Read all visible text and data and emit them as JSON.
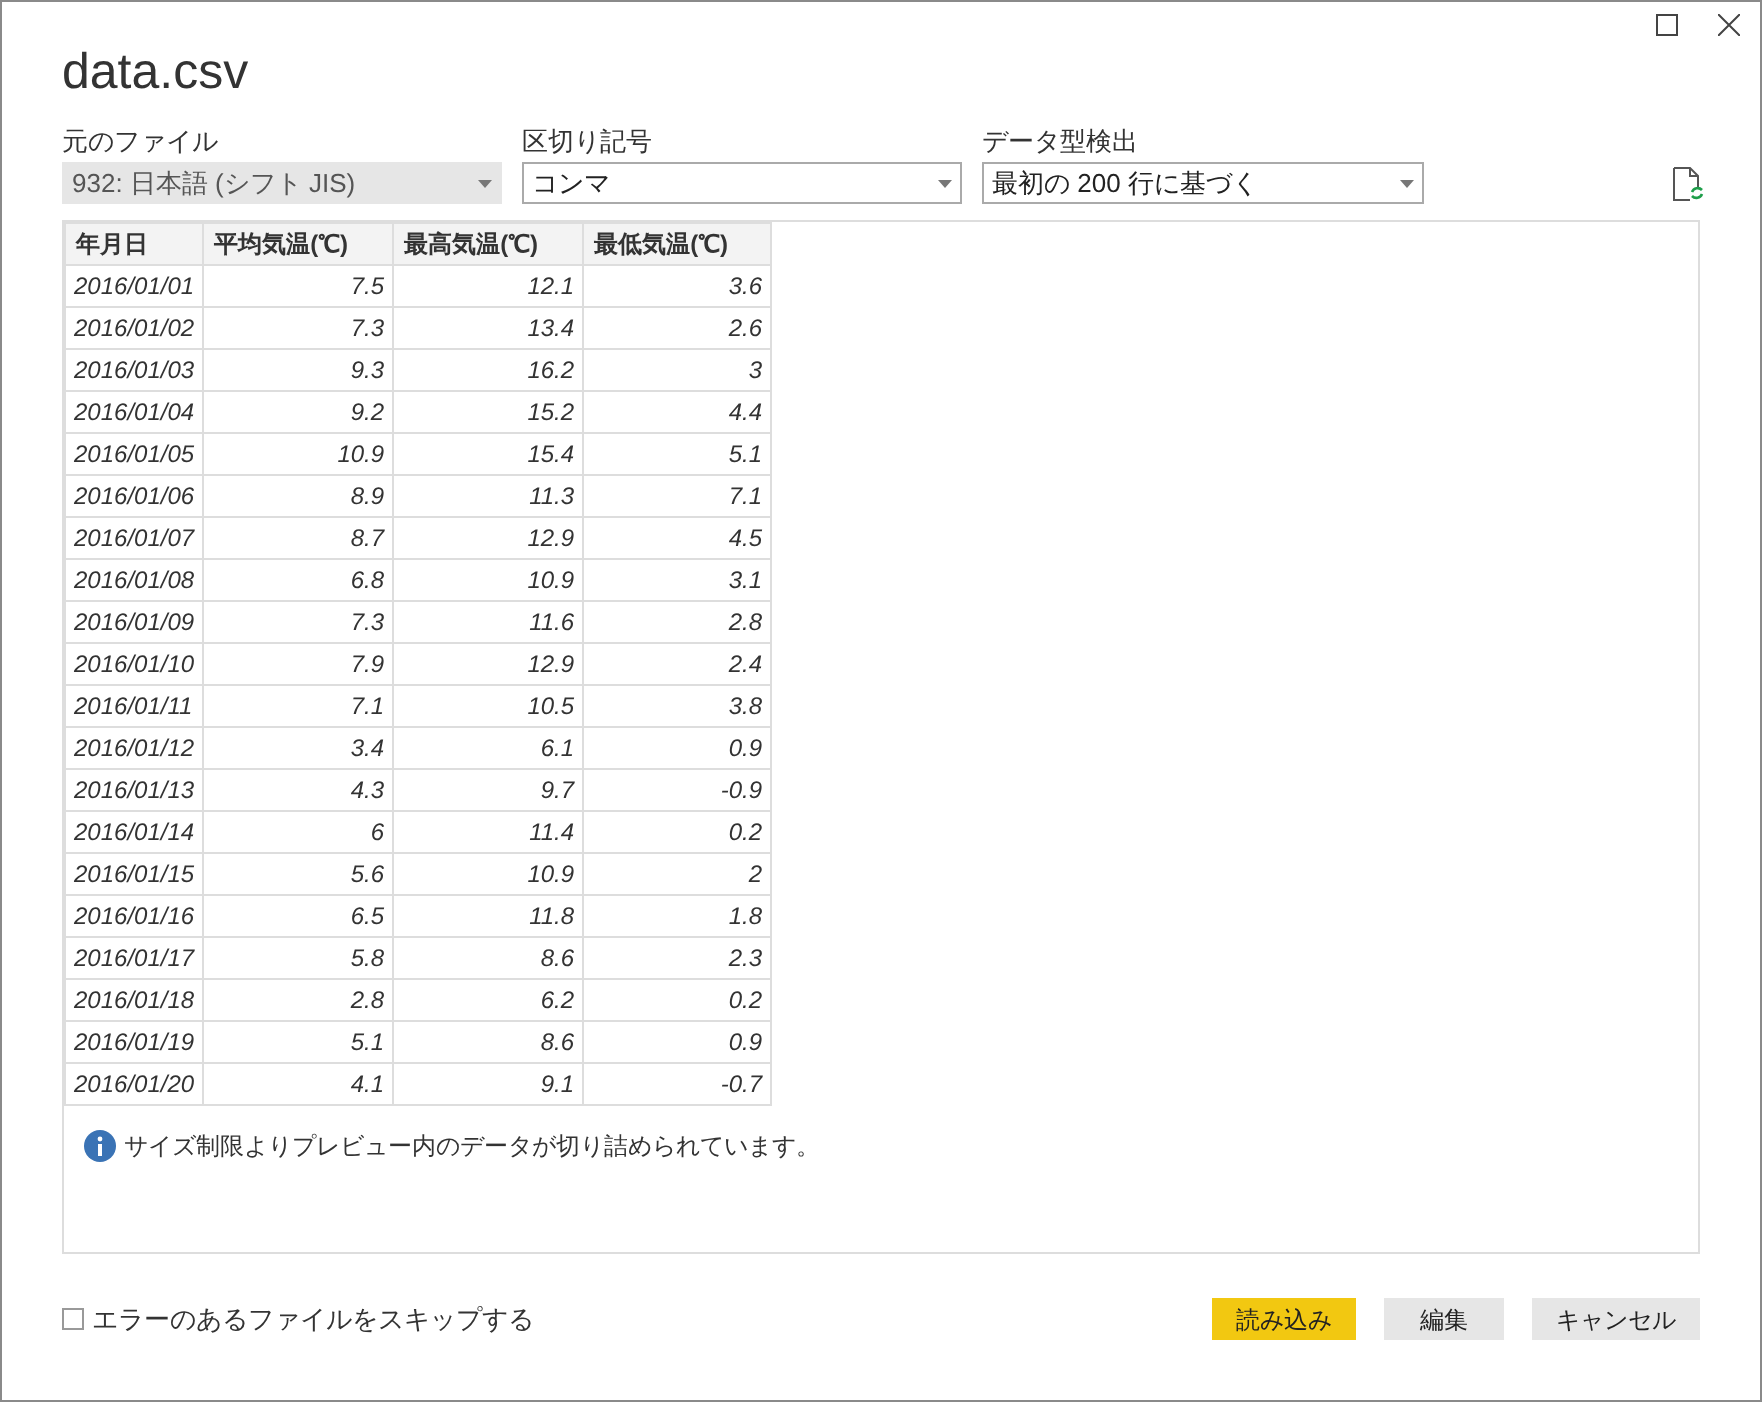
{
  "window": {
    "title": "data.csv"
  },
  "selectors": [
    {
      "label": "元のファイル",
      "value": "932: 日本語 (シフト JIS)",
      "disabled": true
    },
    {
      "label": "区切り記号",
      "value": "コンマ",
      "disabled": false
    },
    {
      "label": "データ型検出",
      "value": "最初の 200 行に基づく",
      "disabled": false
    }
  ],
  "table": {
    "columns": [
      "年月日",
      "平均気温(℃)",
      "最高気温(℃)",
      "最低気温(℃)"
    ],
    "rows": [
      [
        "2016/01/01",
        "7.5",
        "12.1",
        "3.6"
      ],
      [
        "2016/01/02",
        "7.3",
        "13.4",
        "2.6"
      ],
      [
        "2016/01/03",
        "9.3",
        "16.2",
        "3"
      ],
      [
        "2016/01/04",
        "9.2",
        "15.2",
        "4.4"
      ],
      [
        "2016/01/05",
        "10.9",
        "15.4",
        "5.1"
      ],
      [
        "2016/01/06",
        "8.9",
        "11.3",
        "7.1"
      ],
      [
        "2016/01/07",
        "8.7",
        "12.9",
        "4.5"
      ],
      [
        "2016/01/08",
        "6.8",
        "10.9",
        "3.1"
      ],
      [
        "2016/01/09",
        "7.3",
        "11.6",
        "2.8"
      ],
      [
        "2016/01/10",
        "7.9",
        "12.9",
        "2.4"
      ],
      [
        "2016/01/11",
        "7.1",
        "10.5",
        "3.8"
      ],
      [
        "2016/01/12",
        "3.4",
        "6.1",
        "0.9"
      ],
      [
        "2016/01/13",
        "4.3",
        "9.7",
        "-0.9"
      ],
      [
        "2016/01/14",
        "6",
        "11.4",
        "0.2"
      ],
      [
        "2016/01/15",
        "5.6",
        "10.9",
        "2"
      ],
      [
        "2016/01/16",
        "6.5",
        "11.8",
        "1.8"
      ],
      [
        "2016/01/17",
        "5.8",
        "8.6",
        "2.3"
      ],
      [
        "2016/01/18",
        "2.8",
        "6.2",
        "0.2"
      ],
      [
        "2016/01/19",
        "5.1",
        "8.6",
        "0.9"
      ],
      [
        "2016/01/20",
        "4.1",
        "9.1",
        "-0.7"
      ]
    ]
  },
  "notice": "サイズ制限よりプレビュー内のデータが切り詰められています。",
  "skip_errors": {
    "label": "エラーのあるファイルをスキップする",
    "checked": false
  },
  "buttons": [
    {
      "label": "読み込み",
      "kind": "primary"
    },
    {
      "label": "編集",
      "kind": "secondary"
    },
    {
      "label": "キャンセル",
      "kind": "secondary"
    }
  ]
}
